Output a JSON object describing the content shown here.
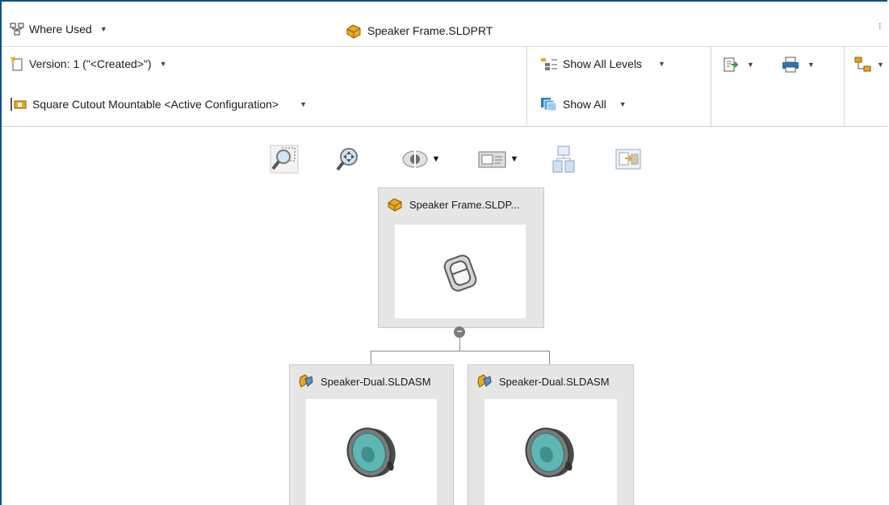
{
  "header": {
    "where_used_label": "Where Used",
    "document_title": "Speaker Frame.SLDPRT"
  },
  "toolbar": {
    "version_label": "Version: 1 (\"<Created>\")",
    "configuration_label": "Square Cutout Mountable <Active Configuration>",
    "show_levels_label": "Show All Levels",
    "show_all_label": "Show All"
  },
  "canvas_tools": [
    {
      "icon": "zoom-to-fit-icon"
    },
    {
      "icon": "zoom-to-area-icon"
    },
    {
      "icon": "visibility-icon"
    },
    {
      "icon": "view-mode-icon"
    },
    {
      "icon": "tree-layout-icon"
    },
    {
      "icon": "preview-icon"
    }
  ],
  "tree": {
    "root": {
      "label": "Speaker Frame.SLDP...",
      "icon": "part-icon"
    },
    "children": [
      {
        "label": "Speaker-Dual.SLDASM",
        "icon": "assembly-icon"
      },
      {
        "label": "Speaker-Dual.SLDASM",
        "icon": "assembly-icon"
      }
    ]
  },
  "colors": {
    "frame_border": "#0f4f85",
    "node_bg": "#e6e6e6",
    "accent_yellow": "#e8a91c",
    "speaker_cone": "#5fb6b2"
  }
}
